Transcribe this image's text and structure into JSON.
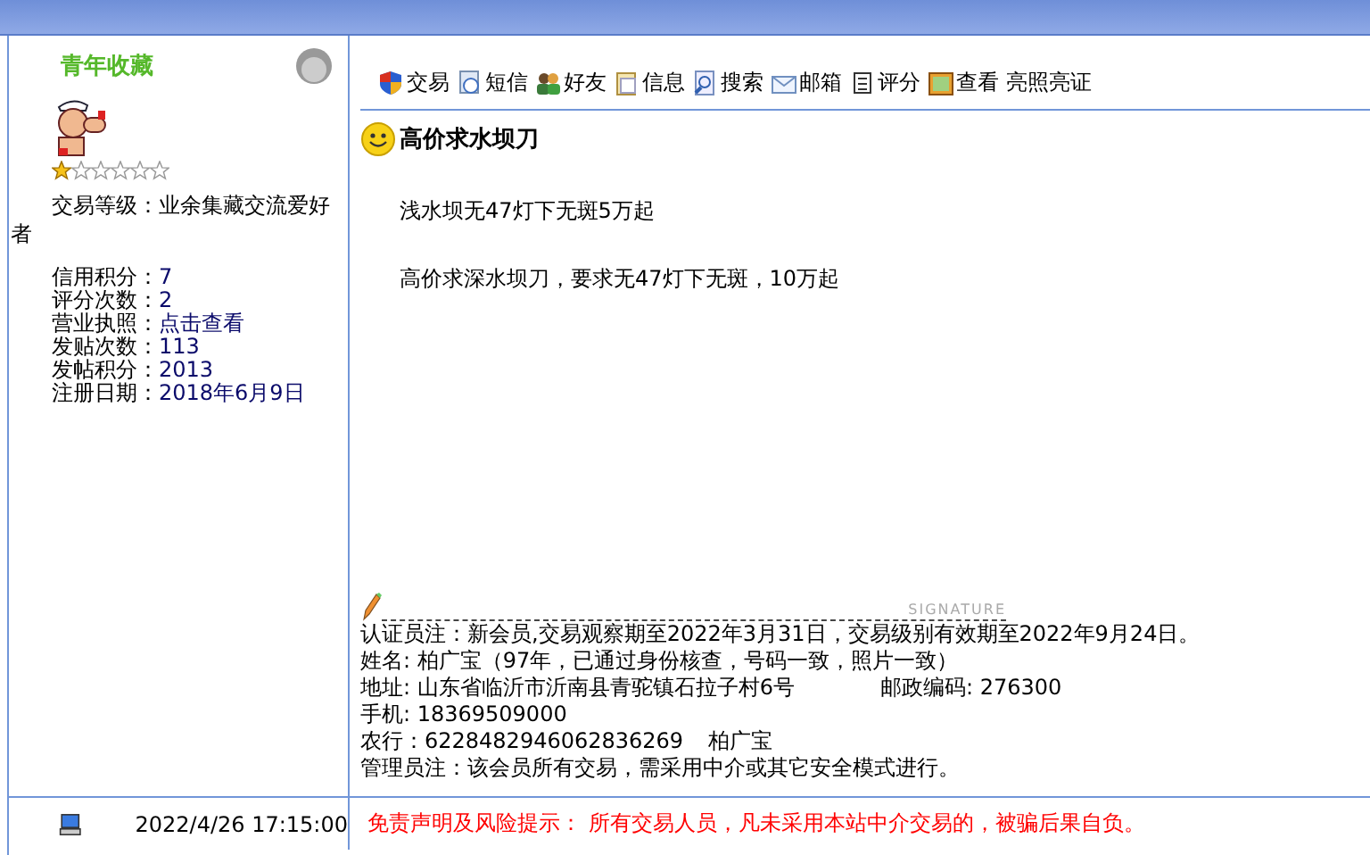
{
  "profile": {
    "username": "青年收藏",
    "stars": 1,
    "level_line": "交易等级：业余集藏交流爱好者",
    "fields": [
      {
        "label": "信用积分：",
        "value": "7"
      },
      {
        "label": "评分次数：",
        "value": "2"
      },
      {
        "label": "营业执照：",
        "value": "点击查看"
      },
      {
        "label": "发贴次数：",
        "value": "113"
      },
      {
        "label": "发帖积分：",
        "value": "2013"
      },
      {
        "label": "注册日期：",
        "value": "2018年6月9日"
      }
    ]
  },
  "toolbar": [
    {
      "kind": "shield",
      "label": "交易"
    },
    {
      "kind": "message",
      "label": "短信"
    },
    {
      "kind": "friends",
      "label": "好友"
    },
    {
      "kind": "clipboard",
      "label": "信息"
    },
    {
      "kind": "search",
      "label": "搜索"
    },
    {
      "kind": "mail",
      "label": "邮箱"
    },
    {
      "kind": "note",
      "label": "评分"
    },
    {
      "kind": "picture",
      "label": "查看"
    },
    {
      "kind": "text",
      "label": "亮照亮证"
    }
  ],
  "post": {
    "title": "高价求水坝刀",
    "paragraphs": [
      "浅水坝无47灯下无斑5万起",
      "高价求深水坝刀，要求无47灯下无斑，10万起"
    ]
  },
  "signature": {
    "mark": "SIGNATURE",
    "lines": [
      "认证员注：新会员,交易观察期至2022年3月31日，交易级别有效期至2022年9月24日。",
      "姓名: 柏广宝（97年，已通过身份核查，号码一致，照片一致）"
    ],
    "address": {
      "label": "地址: 山东省临沂市沂南县青驼镇石拉子村6号",
      "postcode": "邮政编码: 276300"
    },
    "more_lines": [
      "手机: 18369509000"
    ],
    "bank": {
      "label": "农行：",
      "number": "6228482946062836269",
      "name": "柏广宝"
    },
    "note": "管理员注：该会员所有交易，需采用中介或其它安全模式进行。"
  },
  "footer": {
    "time": "2022/4/26 17:15:00",
    "disclaimer": "免责声明及风险提示： 所有交易人员，凡未采用本站中介交易的，被骗后果自负。"
  }
}
